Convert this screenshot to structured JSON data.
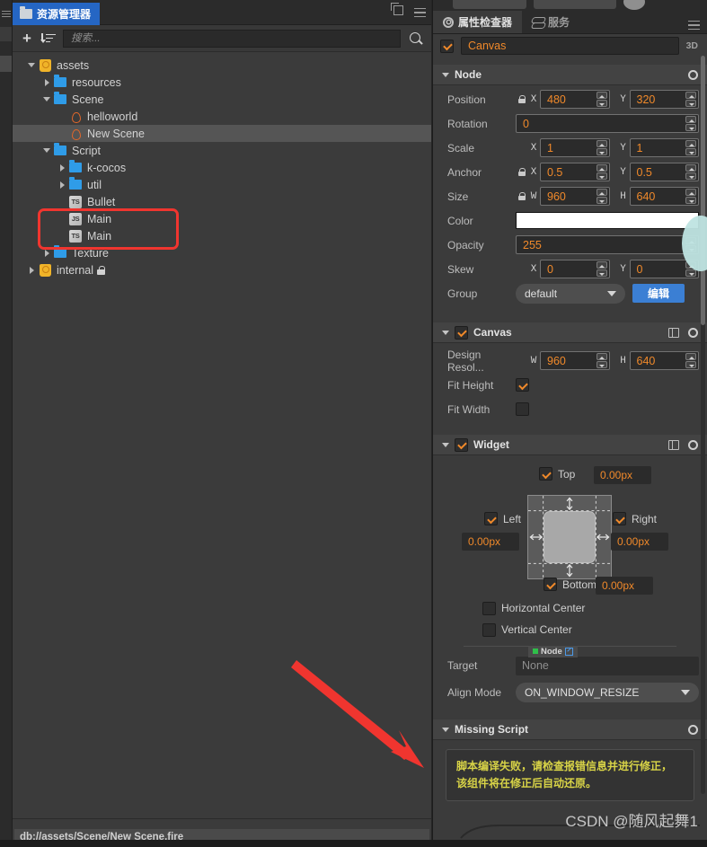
{
  "left_panel": {
    "tab_label": "资源管理器",
    "toolbar": {
      "add_label": "+",
      "sort_label": "sort",
      "search_placeholder": "搜索...",
      "search_value": ""
    },
    "tree": [
      {
        "label": "assets",
        "depth": 0,
        "icon": "assets-root-icon",
        "expander": "down",
        "selected": false,
        "locked": false
      },
      {
        "label": "resources",
        "depth": 1,
        "icon": "folder-icon",
        "expander": "right",
        "selected": false,
        "locked": false
      },
      {
        "label": "Scene",
        "depth": 1,
        "icon": "folder-icon",
        "expander": "down",
        "selected": false,
        "locked": false
      },
      {
        "label": "helloworld",
        "depth": 2,
        "icon": "scene-fire-icon",
        "expander": "none",
        "selected": false,
        "locked": false
      },
      {
        "label": "New Scene",
        "depth": 2,
        "icon": "scene-fire-icon",
        "expander": "none",
        "selected": true,
        "locked": false
      },
      {
        "label": "Script",
        "depth": 1,
        "icon": "folder-icon",
        "expander": "down",
        "selected": false,
        "locked": false
      },
      {
        "label": "k-cocos",
        "depth": 2,
        "icon": "folder-icon",
        "expander": "right",
        "selected": false,
        "locked": false
      },
      {
        "label": "util",
        "depth": 2,
        "icon": "folder-icon",
        "expander": "right",
        "selected": false,
        "locked": false
      },
      {
        "label": "Bullet",
        "depth": 2,
        "icon": "ts-file-icon",
        "expander": "none",
        "selected": false,
        "locked": false
      },
      {
        "label": "Main",
        "depth": 2,
        "icon": "js-file-icon",
        "expander": "none",
        "selected": false,
        "locked": false
      },
      {
        "label": "Main",
        "depth": 2,
        "icon": "ts-file-icon",
        "expander": "none",
        "selected": false,
        "locked": false
      },
      {
        "label": "Texture",
        "depth": 1,
        "icon": "folder-icon",
        "expander": "right",
        "selected": false,
        "locked": false
      },
      {
        "label": "internal",
        "depth": 0,
        "icon": "assets-root-icon",
        "expander": "right",
        "selected": false,
        "locked": true
      }
    ],
    "path_bar": "db://assets/Scene/New Scene.fire"
  },
  "right_panel": {
    "tabs": [
      {
        "label": "属性检查器",
        "icon": "gear-icon",
        "active": true
      },
      {
        "label": "服务",
        "icon": "service-icon",
        "active": false
      }
    ],
    "node_header": {
      "enabled": true,
      "name": "Canvas",
      "mode_label": "3D"
    },
    "node_section": {
      "title": "Node",
      "rows": [
        {
          "label": "Position",
          "locked": true,
          "fields": [
            {
              "axis": "X",
              "value": "480"
            },
            {
              "axis": "Y",
              "value": "320"
            }
          ]
        },
        {
          "label": "Rotation",
          "locked": false,
          "fields": [
            {
              "axis": "",
              "value": "0"
            }
          ]
        },
        {
          "label": "Scale",
          "locked": false,
          "fields": [
            {
              "axis": "X",
              "value": "1"
            },
            {
              "axis": "Y",
              "value": "1"
            }
          ]
        },
        {
          "label": "Anchor",
          "locked": true,
          "fields": [
            {
              "axis": "X",
              "value": "0.5"
            },
            {
              "axis": "Y",
              "value": "0.5"
            }
          ]
        },
        {
          "label": "Size",
          "locked": true,
          "fields": [
            {
              "axis": "W",
              "value": "960"
            },
            {
              "axis": "H",
              "value": "640"
            }
          ]
        }
      ],
      "color_label": "Color",
      "color_value": "#ffffff",
      "opacity_label": "Opacity",
      "opacity_value": "255",
      "skew_label": "Skew",
      "skew_x": "0",
      "skew_y": "0",
      "group_label": "Group",
      "group_value": "default",
      "group_edit_button": "编辑"
    },
    "canvas_section": {
      "title": "Canvas",
      "enabled": true,
      "design_res_label": "Design Resol...",
      "design_w": "960",
      "design_h": "640",
      "fit_height_label": "Fit Height",
      "fit_height": true,
      "fit_width_label": "Fit Width",
      "fit_width": false
    },
    "widget_section": {
      "title": "Widget",
      "enabled": true,
      "top": {
        "label": "Top",
        "checked": true,
        "value": "0.00px"
      },
      "left": {
        "label": "Left",
        "checked": true,
        "value": "0.00px"
      },
      "right": {
        "label": "Right",
        "checked": true,
        "value": "0.00px"
      },
      "bottom": {
        "label": "Bottom",
        "checked": true,
        "value": "0.00px"
      },
      "horizontal_center": {
        "label": "Horizontal Center",
        "checked": false
      },
      "vertical_center": {
        "label": "Vertical Center",
        "checked": false
      },
      "target_label": "Target",
      "target_chip": "Node",
      "target_value": "None",
      "align_mode_label": "Align Mode",
      "align_mode_value": "ON_WINDOW_RESIZE"
    },
    "missing_script_section": {
      "title": "Missing Script",
      "message_line1": "脚本编译失败，请检查报错信息并进行修正，",
      "message_line2": "该组件将在修正后自动还原。"
    }
  },
  "watermark": "CSDN @随风起舞1",
  "accents": {
    "tab_blue": "#2566c4",
    "value_orange": "#f0892a",
    "button_blue": "#3b7fd4",
    "warning_yellow": "#d9d447",
    "annotation_red": "#f0352f",
    "folder_blue": "#2f9ce8"
  }
}
